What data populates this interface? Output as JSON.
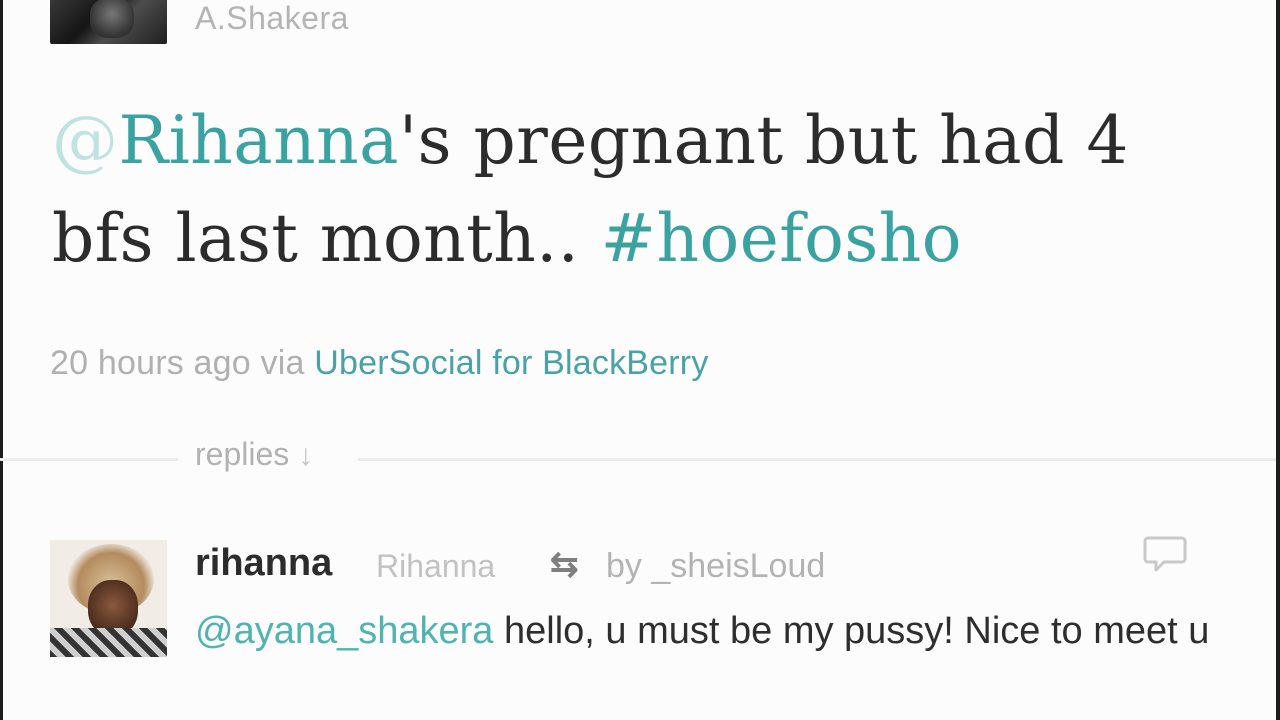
{
  "top_tweet": {
    "author_full_name": "A.Shakera",
    "text_mention_at": "@",
    "text_mention_name": "Rihanna",
    "text_part1": "'s pregnant but had 4 bfs last month.. ",
    "text_hashtag": "#hoefosho",
    "timestamp": "20 hours ago",
    "via_label": "via",
    "source": "UberSocial for BlackBerry"
  },
  "replies": {
    "label": "replies",
    "arrow": "↓"
  },
  "reply": {
    "screen_name": "rihanna",
    "full_name": "Rihanna",
    "retweet_glyph": "⇆",
    "retweet_by": "by _sheisLoud",
    "mention": "@ayana_shakera",
    "text": " hello, u must be my pussy! Nice to meet u"
  },
  "icons": {
    "top_avatar": "avatar",
    "reply_avatar": "avatar",
    "retweet": "retweet-icon",
    "reply": "reply-icon"
  }
}
